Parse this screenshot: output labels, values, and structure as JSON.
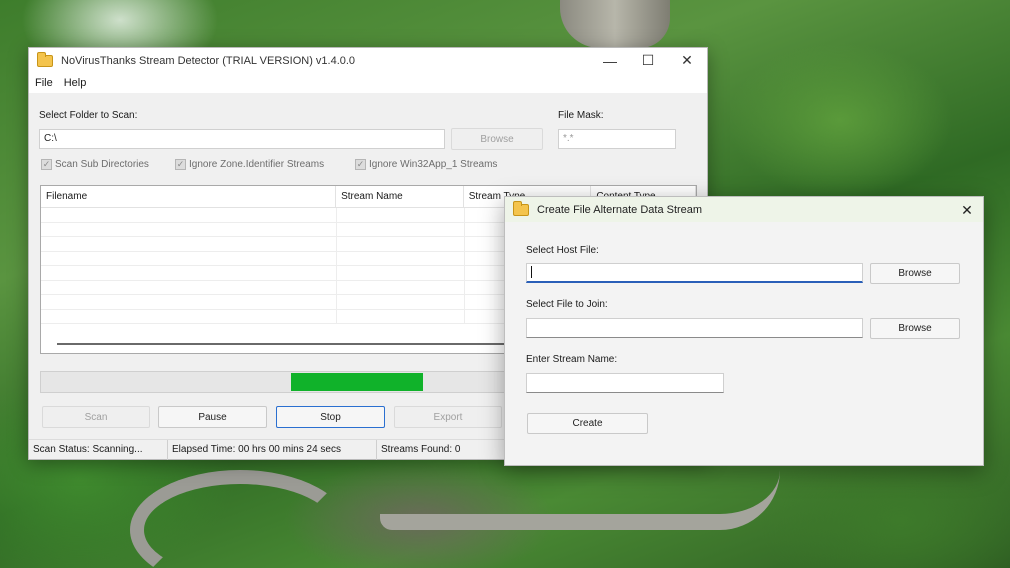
{
  "main_window": {
    "title": "NoVirusThanks Stream Detector (TRIAL VERSION) v1.4.0.0",
    "controls": {
      "minimize": "—",
      "maximize": "☐",
      "close": "✕"
    },
    "menu": [
      "File",
      "Help"
    ],
    "folder_label": "Select Folder to Scan:",
    "folder_value": "C:\\",
    "browse_label": "Browse",
    "mask_label": "File Mask:",
    "mask_value": "*.*",
    "checkboxes": [
      {
        "label": "Scan Sub Directories",
        "checked": true
      },
      {
        "label": "Ignore Zone.Identifier Streams",
        "checked": true
      },
      {
        "label": "Ignore Win32App_1 Streams",
        "checked": true
      }
    ],
    "table": {
      "columns": [
        "Filename",
        "Stream Name",
        "Stream Type",
        "Content Type"
      ],
      "rows": []
    },
    "progress": {
      "fill_start": 0.38,
      "fill_end": 0.58
    },
    "buttons": {
      "scan": "Scan",
      "pause": "Pause",
      "stop": "Stop",
      "export": "Export"
    },
    "status": {
      "scan_status": "Scan Status: Scanning...",
      "elapsed": "Elapsed Time: 00 hrs 00 mins 24 secs",
      "streams_found": "Streams Found: 0"
    }
  },
  "dialog": {
    "title": "Create File Alternate Data Stream",
    "close": "✕",
    "host_label": "Select Host File:",
    "host_value": "",
    "host_browse": "Browse",
    "join_label": "Select File to Join:",
    "join_value": "",
    "join_browse": "Browse",
    "stream_label": "Enter Stream Name:",
    "stream_value": "",
    "create_label": "Create"
  }
}
